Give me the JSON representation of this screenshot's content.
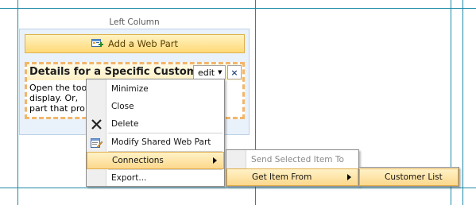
{
  "zone": {
    "label": "Left Column",
    "add_web_part": "Add a Web Part"
  },
  "webpart": {
    "title": "Details for a Specific Customer",
    "edit_label": "edit",
    "close_glyph": "×",
    "body_lines": [
      "Open the too",
      "display. Or,",
      "part that pro"
    ]
  },
  "menu": {
    "items": [
      {
        "label": "Minimize"
      },
      {
        "label": "Close"
      },
      {
        "label": "Delete",
        "icon": "delete-x-icon"
      },
      {
        "label": "Modify Shared Web Part",
        "icon": "modify-web-part-icon"
      },
      {
        "label": "Connections",
        "submenu": true,
        "highlighted": true
      },
      {
        "label": "Export..."
      }
    ]
  },
  "connections_menu": {
    "items": [
      {
        "label": "Send Selected Item To",
        "disabled": true
      },
      {
        "label": "Get Item From",
        "submenu": true,
        "highlighted": true
      }
    ]
  },
  "get_item_menu": {
    "items": [
      {
        "label": "Customer List",
        "highlighted": true
      }
    ]
  }
}
